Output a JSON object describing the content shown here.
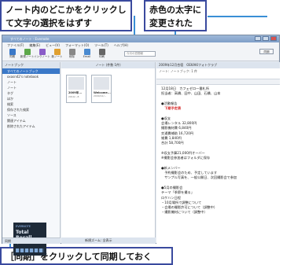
{
  "callouts": {
    "top_left": "ノート内のどこかをクリックして文字の選択をはずす",
    "top_right": "赤色の太字に変更された",
    "bottom": "［同期］をクリックして同期しておく"
  },
  "window": {
    "title": "すべてのノート - Evernote",
    "menu": [
      "ファイル(F)",
      "編集(E)",
      "ビュー(V)",
      "フォーマット(O)",
      "ツール(T)",
      "ヘルプ(H)"
    ],
    "toolbar": [
      {
        "label": "同期",
        "icon": "sync-icon",
        "color": "#3a78c8"
      },
      {
        "label": "新規ノート",
        "icon": "new-note-icon",
        "color": "#5ca84a"
      },
      {
        "label": "インクノート",
        "icon": "ink-note-icon",
        "color": "#8a5cc8"
      },
      {
        "label": "新ノート",
        "icon": "note-icon",
        "color": "#e0a030"
      },
      {
        "label": "削除",
        "icon": "trash-icon",
        "color": "#888888"
      },
      {
        "label": "Email",
        "icon": "email-icon",
        "color": "#4a8ad0"
      },
      {
        "label": "印刷",
        "icon": "print-icon",
        "color": "#666666"
      }
    ],
    "search_placeholder": "今月の週間報"
  },
  "sidebar": {
    "header": "ノートブック",
    "items": [
      "すべてのノートブック",
      "oxasn42's notebook",
      "ノート",
      "ノート",
      "タグ",
      "ほか",
      "検索",
      "保存された検索",
      "ソース",
      "関連アイテム",
      "削除されたアイテム"
    ],
    "ad": {
      "tag": "EVERNOTE",
      "title": "Total Recall",
      "sub": "By Gordon Bell"
    },
    "sync_label": "同期"
  },
  "notelist": {
    "header": "ノート (件数 1件)",
    "notes": [
      {
        "title": "2009年...",
        "date": "2010/...8"
      },
      {
        "title": "Welcome...",
        "date": "2009/12/..."
      }
    ],
    "status": "新規ズーム: 全表示"
  },
  "note": {
    "header": "2009年12月合宿　OEKAKIフォトクラブ",
    "meta": "ノート: ノートブック: 1 件",
    "lines": [
      {
        "text": "12月18日　カフェゼロ一番札所",
        "red": false
      },
      {
        "text": "担当者：高橋、田中、山田、石橋、山本",
        "red": false
      },
      {
        "text": "",
        "red": false
      },
      {
        "text": "●活動報告",
        "red": false
      },
      {
        "text": "　下期予定表",
        "red": true
      },
      {
        "text": "",
        "red": false
      },
      {
        "text": "●収支",
        "red": false
      },
      {
        "text": "会場レンタル 32,800円",
        "red": false
      },
      {
        "text": "撮影機材費 6,840円",
        "red": false
      },
      {
        "text": "交通費補助 16,720円",
        "red": false
      },
      {
        "text": "雑費 1,840円",
        "red": false
      },
      {
        "text": "合計 58,700円",
        "red": false
      },
      {
        "text": "",
        "red": false
      },
      {
        "text": "※収支予算21,000円オーバー",
        "red": false
      },
      {
        "text": "※撮影会参加者はフォルダに保存",
        "red": false
      },
      {
        "text": "",
        "red": false
      },
      {
        "text": "●新メンバー",
        "red": false
      },
      {
        "text": "　予約撮影会のため、予定しています",
        "red": false
      },
      {
        "text": "　サンプル写真を、一般公開日、次回撮影会で参加",
        "red": false
      },
      {
        "text": "",
        "red": false
      },
      {
        "text": "●5月の撮影会",
        "red": false
      },
      {
        "text": "テーマ「季節を撮る」",
        "red": false
      },
      {
        "text": "ロケハン日程",
        "red": false
      },
      {
        "text": "・10月場所で調整について",
        "red": false
      },
      {
        "text": "・会場の撮影許可について（調整中）",
        "red": false
      },
      {
        "text": "・撮影機材について（調整中）",
        "red": false
      }
    ],
    "sync_button": "同期"
  }
}
